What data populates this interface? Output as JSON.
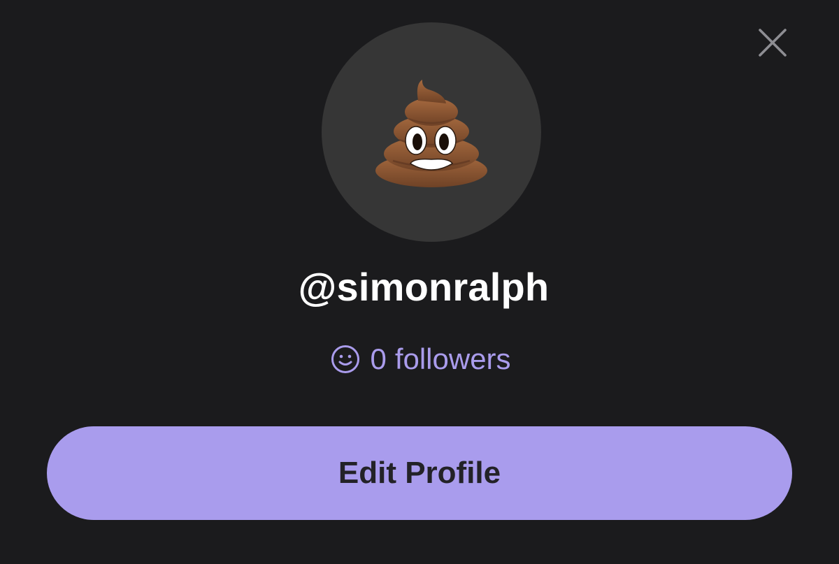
{
  "profile": {
    "username": "@simonralph",
    "followers_count": "0",
    "followers_label": "followers",
    "avatar_icon": "pile-of-poo-emoji"
  },
  "actions": {
    "edit_profile_label": "Edit Profile",
    "close_icon": "close-icon"
  },
  "colors": {
    "background": "#1b1b1d",
    "avatar_circle": "#363636",
    "accent": "#a99ced",
    "accent_text": "#aa9cec",
    "button_text": "#232227",
    "close_icon": "#8e8e93"
  }
}
